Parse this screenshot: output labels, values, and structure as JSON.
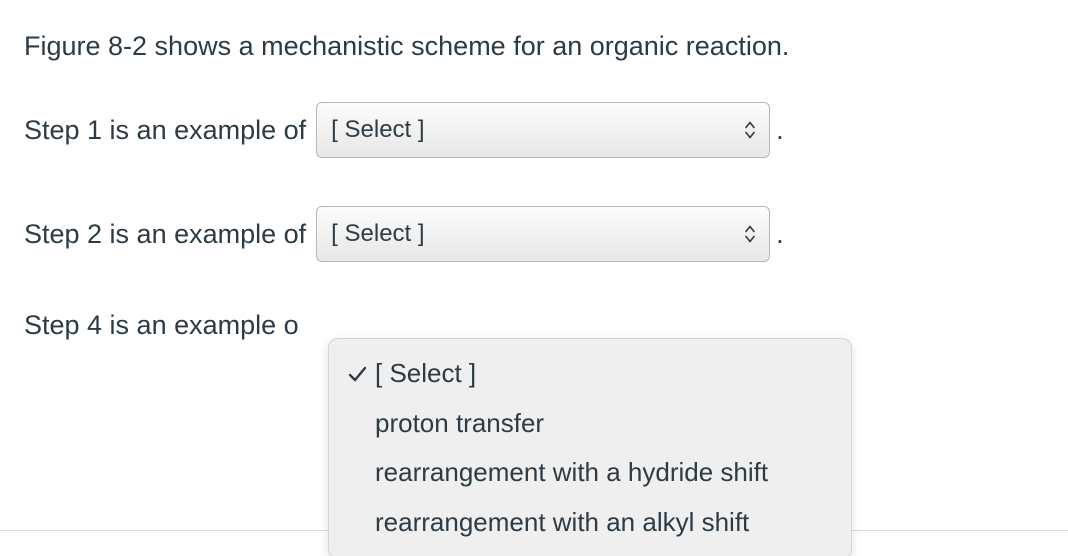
{
  "intro": "Figure 8-2 shows a mechanistic scheme for an organic reaction.",
  "period": ".",
  "rows": {
    "r1": {
      "label": "Step 1 is an example of",
      "select": "[ Select ]"
    },
    "r2": {
      "label": "Step 2 is an example of",
      "select": "[ Select ]"
    },
    "r3": {
      "label": "Step 4 is an example o"
    }
  },
  "dropdown": {
    "items": [
      {
        "label": "[ Select ]",
        "checked": true
      },
      {
        "label": "proton transfer",
        "checked": false
      },
      {
        "label": "rearrangement with a hydride shift",
        "checked": false
      },
      {
        "label": "rearrangement with an alkyl shift",
        "checked": false
      }
    ]
  }
}
